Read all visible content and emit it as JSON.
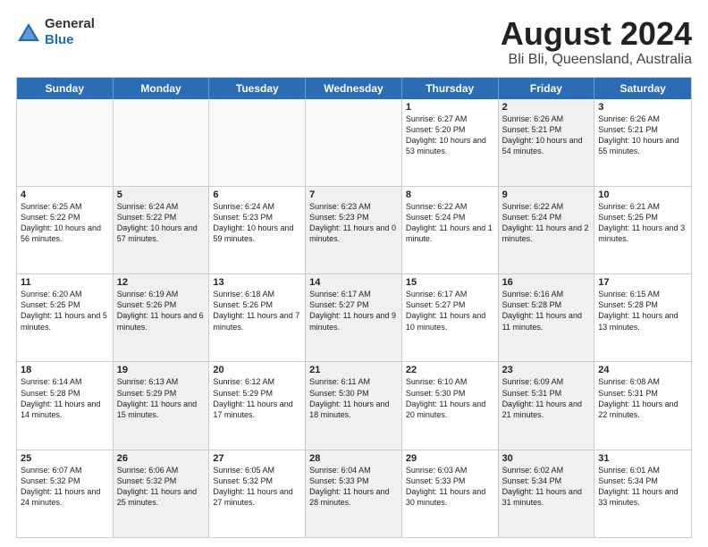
{
  "logo": {
    "general": "General",
    "blue": "Blue"
  },
  "title": "August 2024",
  "subtitle": "Bli Bli, Queensland, Australia",
  "header_days": [
    "Sunday",
    "Monday",
    "Tuesday",
    "Wednesday",
    "Thursday",
    "Friday",
    "Saturday"
  ],
  "rows": [
    [
      {
        "day": "",
        "text": "",
        "empty": true
      },
      {
        "day": "",
        "text": "",
        "empty": true
      },
      {
        "day": "",
        "text": "",
        "empty": true
      },
      {
        "day": "",
        "text": "",
        "empty": true
      },
      {
        "day": "1",
        "text": "Sunrise: 6:27 AM\nSunset: 5:20 PM\nDaylight: 10 hours\nand 53 minutes.",
        "empty": false
      },
      {
        "day": "2",
        "text": "Sunrise: 6:26 AM\nSunset: 5:21 PM\nDaylight: 10 hours\nand 54 minutes.",
        "empty": false,
        "shaded": true
      },
      {
        "day": "3",
        "text": "Sunrise: 6:26 AM\nSunset: 5:21 PM\nDaylight: 10 hours\nand 55 minutes.",
        "empty": false
      }
    ],
    [
      {
        "day": "4",
        "text": "Sunrise: 6:25 AM\nSunset: 5:22 PM\nDaylight: 10 hours\nand 56 minutes.",
        "empty": false
      },
      {
        "day": "5",
        "text": "Sunrise: 6:24 AM\nSunset: 5:22 PM\nDaylight: 10 hours\nand 57 minutes.",
        "empty": false,
        "shaded": true
      },
      {
        "day": "6",
        "text": "Sunrise: 6:24 AM\nSunset: 5:23 PM\nDaylight: 10 hours\nand 59 minutes.",
        "empty": false
      },
      {
        "day": "7",
        "text": "Sunrise: 6:23 AM\nSunset: 5:23 PM\nDaylight: 11 hours\nand 0 minutes.",
        "empty": false,
        "shaded": true
      },
      {
        "day": "8",
        "text": "Sunrise: 6:22 AM\nSunset: 5:24 PM\nDaylight: 11 hours\nand 1 minute.",
        "empty": false
      },
      {
        "day": "9",
        "text": "Sunrise: 6:22 AM\nSunset: 5:24 PM\nDaylight: 11 hours\nand 2 minutes.",
        "empty": false,
        "shaded": true
      },
      {
        "day": "10",
        "text": "Sunrise: 6:21 AM\nSunset: 5:25 PM\nDaylight: 11 hours\nand 3 minutes.",
        "empty": false
      }
    ],
    [
      {
        "day": "11",
        "text": "Sunrise: 6:20 AM\nSunset: 5:25 PM\nDaylight: 11 hours\nand 5 minutes.",
        "empty": false
      },
      {
        "day": "12",
        "text": "Sunrise: 6:19 AM\nSunset: 5:26 PM\nDaylight: 11 hours\nand 6 minutes.",
        "empty": false,
        "shaded": true
      },
      {
        "day": "13",
        "text": "Sunrise: 6:18 AM\nSunset: 5:26 PM\nDaylight: 11 hours\nand 7 minutes.",
        "empty": false
      },
      {
        "day": "14",
        "text": "Sunrise: 6:17 AM\nSunset: 5:27 PM\nDaylight: 11 hours\nand 9 minutes.",
        "empty": false,
        "shaded": true
      },
      {
        "day": "15",
        "text": "Sunrise: 6:17 AM\nSunset: 5:27 PM\nDaylight: 11 hours\nand 10 minutes.",
        "empty": false
      },
      {
        "day": "16",
        "text": "Sunrise: 6:16 AM\nSunset: 5:28 PM\nDaylight: 11 hours\nand 11 minutes.",
        "empty": false,
        "shaded": true
      },
      {
        "day": "17",
        "text": "Sunrise: 6:15 AM\nSunset: 5:28 PM\nDaylight: 11 hours\nand 13 minutes.",
        "empty": false
      }
    ],
    [
      {
        "day": "18",
        "text": "Sunrise: 6:14 AM\nSunset: 5:28 PM\nDaylight: 11 hours\nand 14 minutes.",
        "empty": false
      },
      {
        "day": "19",
        "text": "Sunrise: 6:13 AM\nSunset: 5:29 PM\nDaylight: 11 hours\nand 15 minutes.",
        "empty": false,
        "shaded": true
      },
      {
        "day": "20",
        "text": "Sunrise: 6:12 AM\nSunset: 5:29 PM\nDaylight: 11 hours\nand 17 minutes.",
        "empty": false
      },
      {
        "day": "21",
        "text": "Sunrise: 6:11 AM\nSunset: 5:30 PM\nDaylight: 11 hours\nand 18 minutes.",
        "empty": false,
        "shaded": true
      },
      {
        "day": "22",
        "text": "Sunrise: 6:10 AM\nSunset: 5:30 PM\nDaylight: 11 hours\nand 20 minutes.",
        "empty": false
      },
      {
        "day": "23",
        "text": "Sunrise: 6:09 AM\nSunset: 5:31 PM\nDaylight: 11 hours\nand 21 minutes.",
        "empty": false,
        "shaded": true
      },
      {
        "day": "24",
        "text": "Sunrise: 6:08 AM\nSunset: 5:31 PM\nDaylight: 11 hours\nand 22 minutes.",
        "empty": false
      }
    ],
    [
      {
        "day": "25",
        "text": "Sunrise: 6:07 AM\nSunset: 5:32 PM\nDaylight: 11 hours\nand 24 minutes.",
        "empty": false
      },
      {
        "day": "26",
        "text": "Sunrise: 6:06 AM\nSunset: 5:32 PM\nDaylight: 11 hours\nand 25 minutes.",
        "empty": false,
        "shaded": true
      },
      {
        "day": "27",
        "text": "Sunrise: 6:05 AM\nSunset: 5:32 PM\nDaylight: 11 hours\nand 27 minutes.",
        "empty": false
      },
      {
        "day": "28",
        "text": "Sunrise: 6:04 AM\nSunset: 5:33 PM\nDaylight: 11 hours\nand 28 minutes.",
        "empty": false,
        "shaded": true
      },
      {
        "day": "29",
        "text": "Sunrise: 6:03 AM\nSunset: 5:33 PM\nDaylight: 11 hours\nand 30 minutes.",
        "empty": false
      },
      {
        "day": "30",
        "text": "Sunrise: 6:02 AM\nSunset: 5:34 PM\nDaylight: 11 hours\nand 31 minutes.",
        "empty": false,
        "shaded": true
      },
      {
        "day": "31",
        "text": "Sunrise: 6:01 AM\nSunset: 5:34 PM\nDaylight: 11 hours\nand 33 minutes.",
        "empty": false
      }
    ]
  ]
}
